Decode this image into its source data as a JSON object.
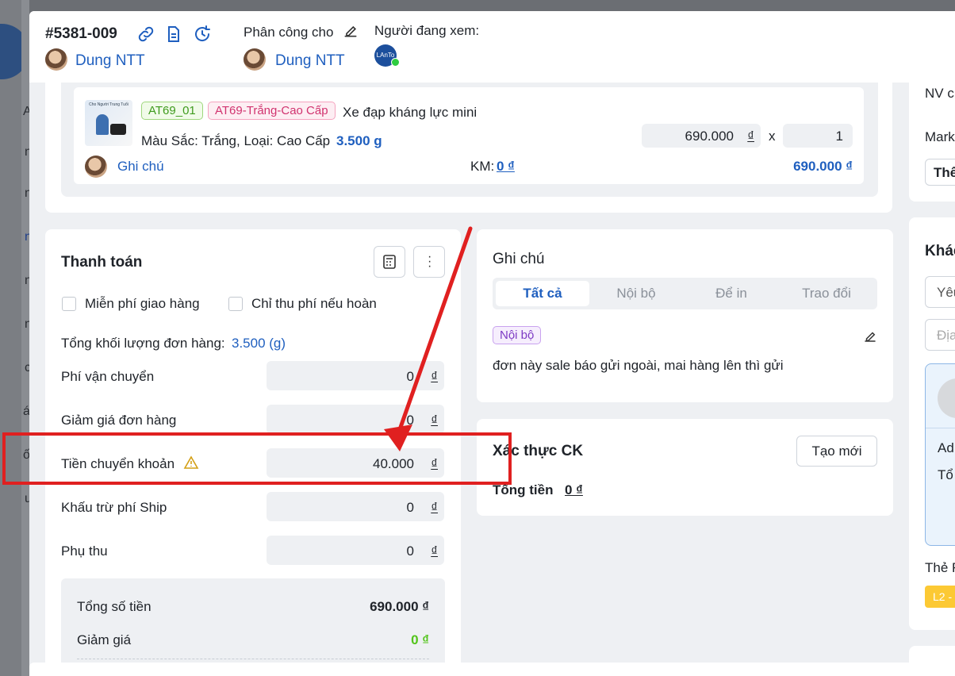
{
  "header": {
    "order_code": "#5381-009",
    "creator_name": "Dung NTT",
    "assign_label": "Phân công cho",
    "assignee_name": "Dung NTT",
    "viewers_label": "Người đang xem:",
    "viewer_avatar_text": "LAnTo"
  },
  "product": {
    "sku_tag": "AT69_01",
    "variant_tag": "AT69-Trắng-Cao Cấp",
    "name": "Xe đạp kháng lực mini",
    "attributes": "Màu Sắc: Trắng, Loại: Cao Cấp",
    "weight": "3.500 g",
    "price": "690.000",
    "currency": "₫",
    "times": "x",
    "quantity": "1",
    "note_link": "Ghi chú",
    "discount_label": "KM:",
    "discount_value": "0 ₫",
    "line_total": "690.000 ₫",
    "thumb_text": "Cho Người Trung Tuổi"
  },
  "payment": {
    "title": "Thanh toán",
    "free_shipping": "Miễn phí giao hàng",
    "charge_if_return": "Chỉ thu phí nếu hoàn",
    "weight_label": "Tổng khối lượng đơn hàng:",
    "weight_value": "3.500 (g)",
    "rows": [
      {
        "label": "Phí vận chuyển",
        "value": "0",
        "unit": "₫"
      },
      {
        "label": "Giảm giá đơn hàng",
        "value": "0",
        "unit": "₫"
      },
      {
        "label": "Tiền chuyển khoản",
        "value": "40.000",
        "unit": "₫"
      },
      {
        "label": "Khấu trừ phí Ship",
        "value": "0",
        "unit": "₫"
      },
      {
        "label": "Phụ thu",
        "value": "0",
        "unit": "₫"
      }
    ],
    "summary": {
      "total_label": "Tổng số tiền",
      "total_value": "690.000 ₫",
      "discount_label": "Giảm giá",
      "discount_value": "0 ₫"
    }
  },
  "notes": {
    "title": "Ghi chú",
    "tabs": [
      "Tất cả",
      "Nội bộ",
      "Để in",
      "Trao đổi"
    ],
    "badge": "Nội bộ",
    "text": "đơn này sale báo gửi ngoài, mai hàng lên thì gửi"
  },
  "verify": {
    "title": "Xác thực CK",
    "create_button": "Tạo mới",
    "total_label": "Tổng tiền",
    "total_value": "0 ₫"
  },
  "right_panel": {
    "nv_label": "NV c",
    "mark_label": "Mark",
    "select_text": "Thê",
    "section_title": "Khác",
    "input1": "Yêu",
    "input2": "Địa",
    "card_line1": "Ad",
    "card_line2": "Tổ",
    "tag_label": "Thẻ F",
    "tag_chip": "L2 -"
  },
  "background": {
    "letters": [
      "A",
      "ng",
      "n",
      "n",
      "n",
      "nh",
      "c",
      "ác",
      "ối",
      "u"
    ]
  },
  "colors": {
    "annotation_red": "#e02020",
    "link_blue": "#1f5fbf",
    "green": "#52c41a"
  }
}
